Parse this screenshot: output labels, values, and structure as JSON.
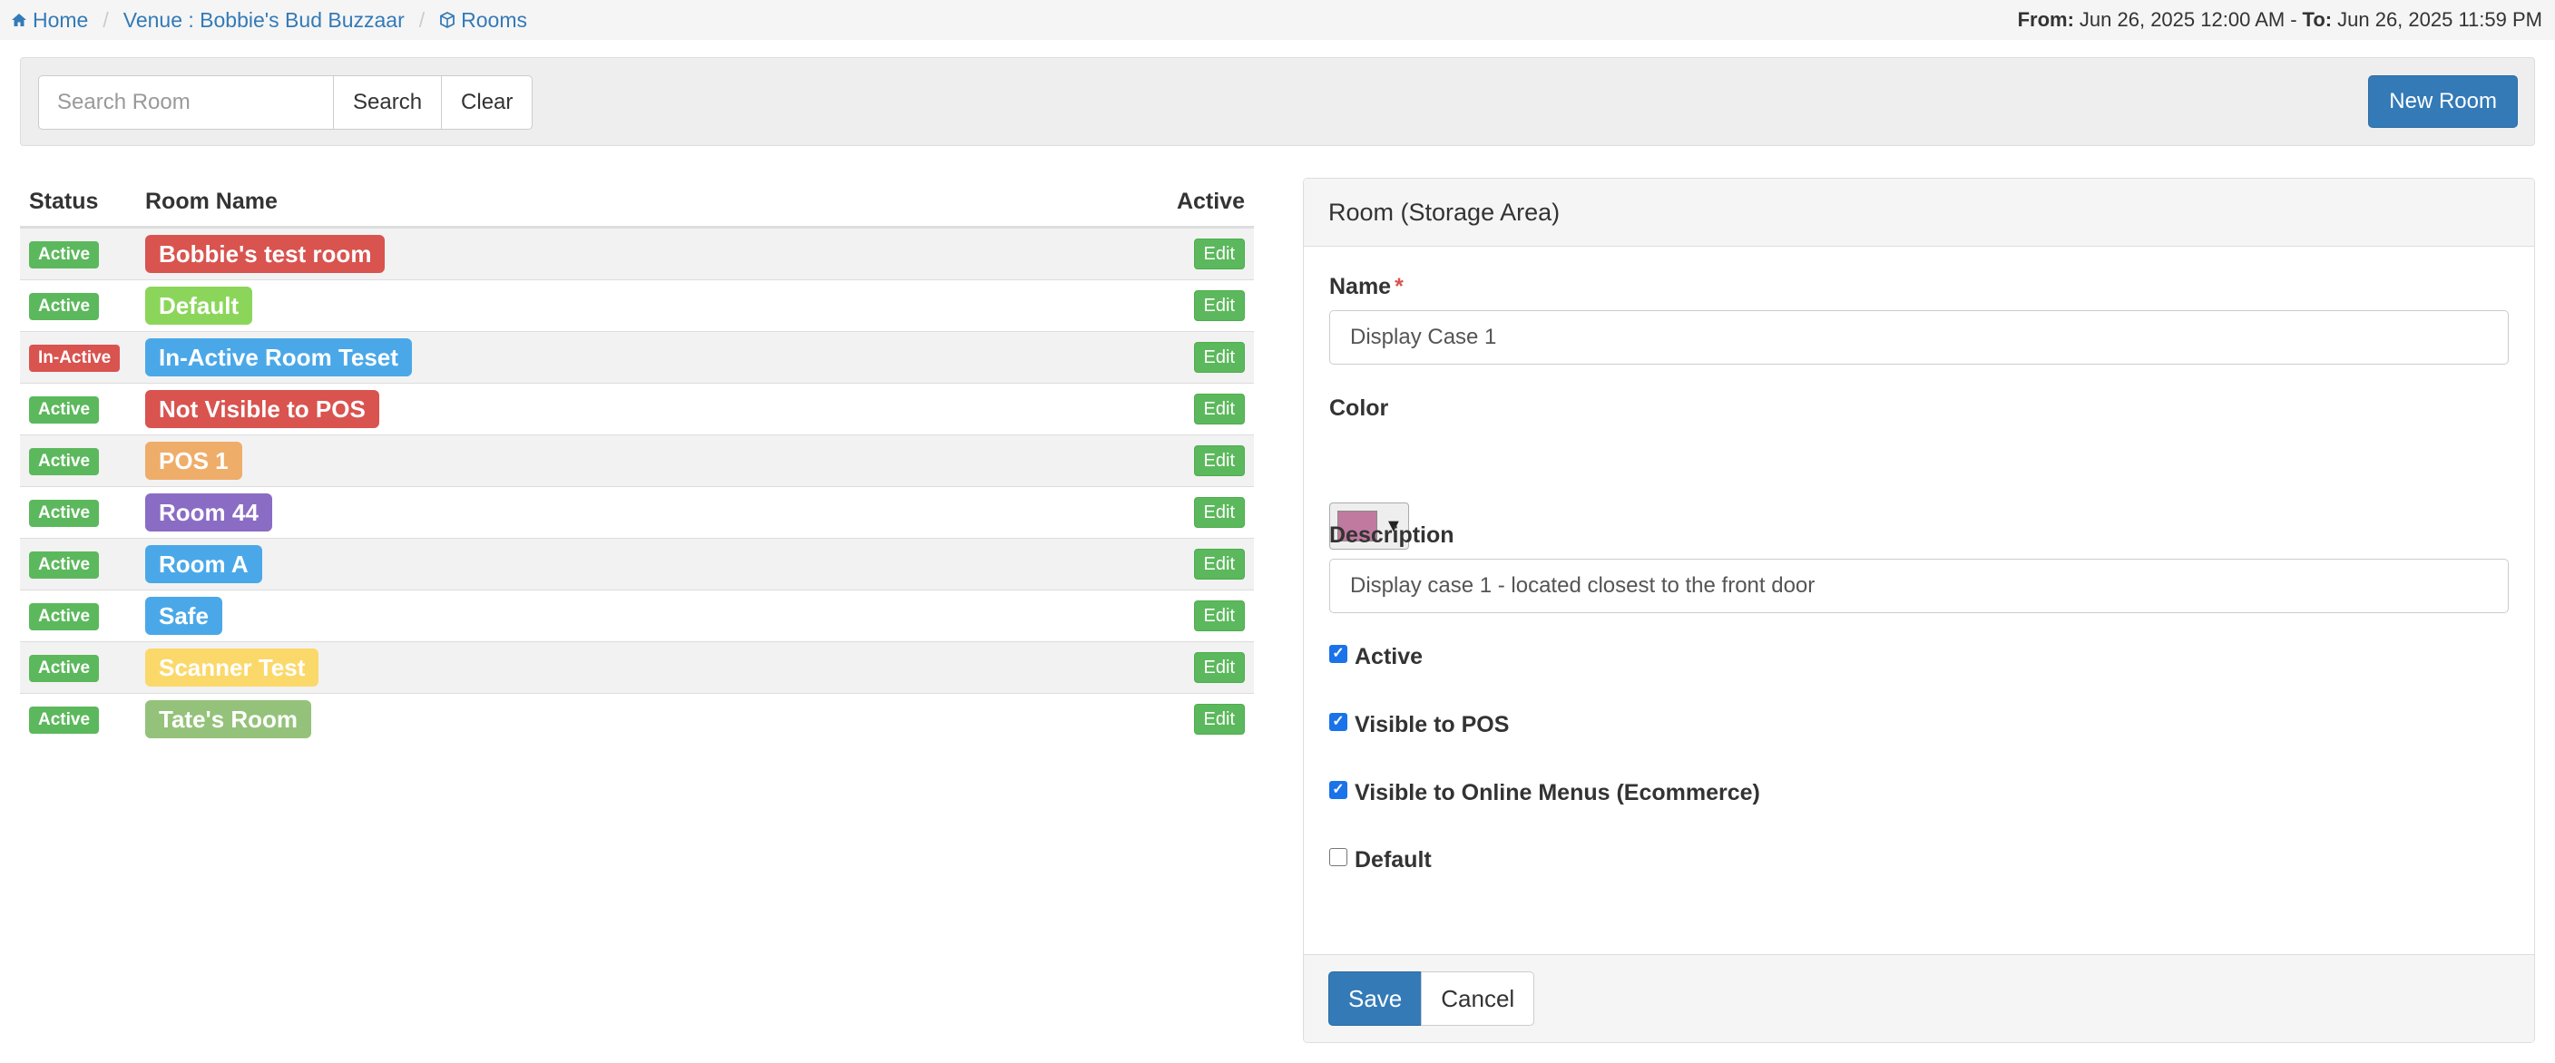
{
  "breadcrumb": {
    "home": "Home",
    "venue": "Venue : Bobbie's Bud Buzzaar",
    "rooms": "Rooms",
    "separator": "/"
  },
  "daterange": {
    "from_label": "From:",
    "from_value": "Jun 26, 2025 12:00 AM",
    "dash": "-",
    "to_label": "To:",
    "to_value": "Jun 26, 2025 11:59 PM"
  },
  "search": {
    "placeholder": "Search Room",
    "value": "",
    "search_label": "Search",
    "clear_label": "Clear"
  },
  "new_room_label": "New Room",
  "table": {
    "headers": {
      "status": "Status",
      "room_name": "Room Name",
      "active": "Active"
    },
    "edit_label": "Edit",
    "rows": [
      {
        "status": "Active",
        "status_color": "#5cb85c",
        "name": "Bobbie's test room",
        "color": "#d9534f"
      },
      {
        "status": "Active",
        "status_color": "#5cb85c",
        "name": "Default",
        "color": "#8bd65a"
      },
      {
        "status": "In-Active",
        "status_color": "#d9534f",
        "name": "In-Active Room Teset",
        "color": "#4aa8e8"
      },
      {
        "status": "Active",
        "status_color": "#5cb85c",
        "name": "Not Visible to POS",
        "color": "#d9534f"
      },
      {
        "status": "Active",
        "status_color": "#5cb85c",
        "name": "POS 1",
        "color": "#efad6a"
      },
      {
        "status": "Active",
        "status_color": "#5cb85c",
        "name": "Room 44",
        "color": "#8a6cc4"
      },
      {
        "status": "Active",
        "status_color": "#5cb85c",
        "name": "Room A",
        "color": "#4aa8e8"
      },
      {
        "status": "Active",
        "status_color": "#5cb85c",
        "name": "Safe",
        "color": "#4aa8e8"
      },
      {
        "status": "Active",
        "status_color": "#5cb85c",
        "name": "Scanner Test",
        "color": "#fbd86a"
      },
      {
        "status": "Active",
        "status_color": "#5cb85c",
        "name": "Tate's Room",
        "color": "#94c27a"
      }
    ]
  },
  "form": {
    "heading": "Room (Storage Area)",
    "name_label": "Name",
    "required_mark": "*",
    "name_value": "Display Case 1",
    "color_label": "Color",
    "color_value": "#c07aa0",
    "color_caret": "▼",
    "description_label": "Description",
    "description_value": "Display case 1 - located closest to the front door",
    "checkboxes": {
      "active": {
        "label": "Active",
        "checked": true
      },
      "visible_pos": {
        "label": "Visible to POS",
        "checked": true
      },
      "visible_online": {
        "label": "Visible to Online Menus (Ecommerce)",
        "checked": true
      },
      "default": {
        "label": "Default",
        "checked": false
      }
    },
    "save_label": "Save",
    "cancel_label": "Cancel"
  }
}
